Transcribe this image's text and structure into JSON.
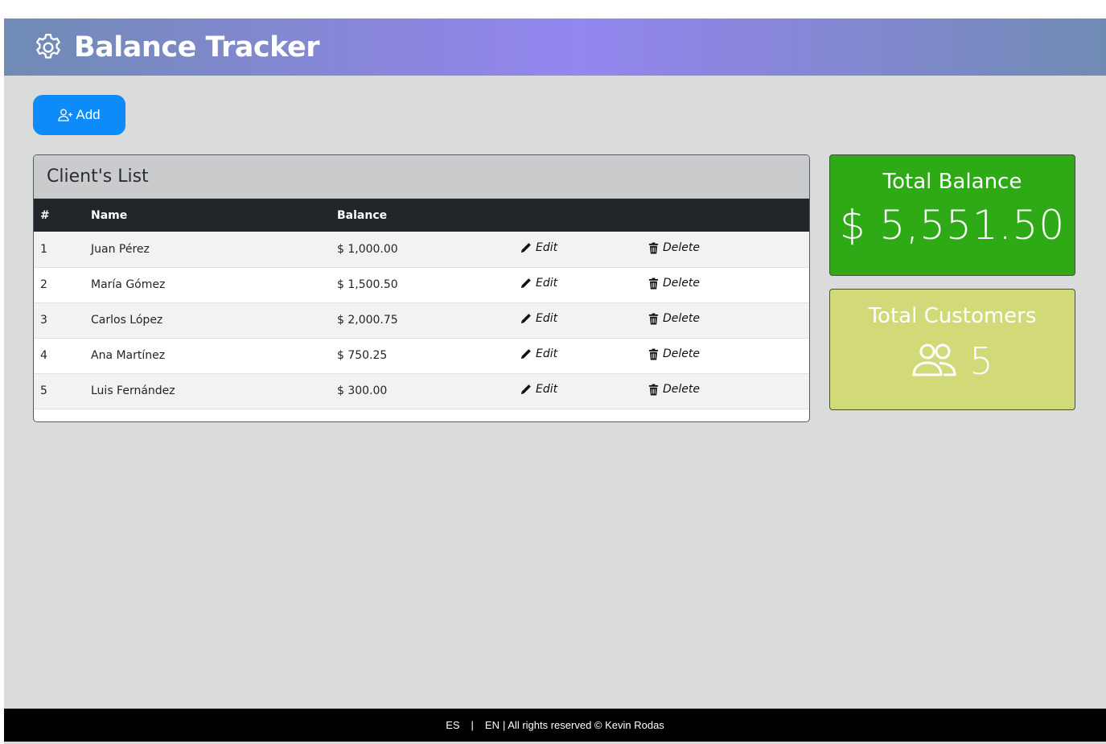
{
  "header": {
    "title": "Balance Tracker",
    "icon": "gear-icon"
  },
  "toolbar": {
    "add_label": "Add",
    "add_icon": "add-user-icon"
  },
  "client_list": {
    "title": "Client's List",
    "columns": {
      "num": "#",
      "name": "Name",
      "balance": "Balance"
    },
    "edit_label": "Edit",
    "delete_label": "Delete",
    "rows": [
      {
        "num": "1",
        "name": "Juan Pérez",
        "balance": "$ 1,000.00"
      },
      {
        "num": "2",
        "name": "María Gómez",
        "balance": "$ 1,500.50"
      },
      {
        "num": "3",
        "name": "Carlos López",
        "balance": "$ 2,000.75"
      },
      {
        "num": "4",
        "name": "Ana Martínez",
        "balance": "$ 750.25"
      },
      {
        "num": "5",
        "name": "Luis Fernández",
        "balance": "$ 300.00"
      }
    ]
  },
  "stats": {
    "balance": {
      "title": "Total Balance",
      "value": "$ 5,551.50",
      "color": "#2eaa17"
    },
    "customers": {
      "title": "Total Customers",
      "value": "5",
      "icon": "users-icon",
      "color": "#d1d978"
    }
  },
  "footer": {
    "lang_es": "ES",
    "sep": "|",
    "lang_en": "EN",
    "rights": "| All rights reserved © Kevin Rodas"
  },
  "colors": {
    "add_button": "#0d8cf9",
    "header_gradient_mid": "#9387f0",
    "footer_bg": "#000000"
  }
}
